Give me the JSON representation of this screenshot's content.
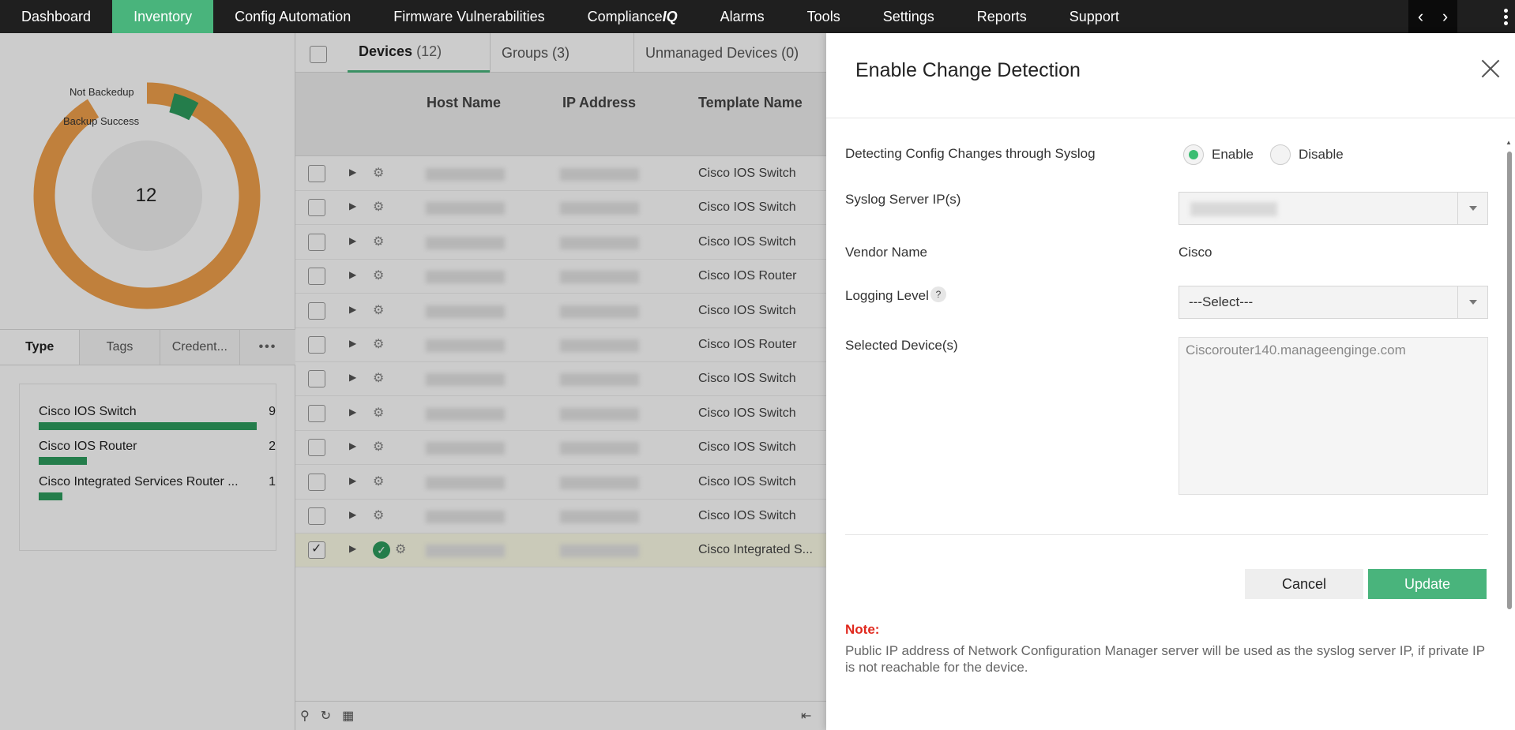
{
  "nav": {
    "items": [
      "Dashboard",
      "Inventory",
      "Config Automation",
      "Firmware Vulnerabilities",
      "Compliance",
      "Alarms",
      "Tools",
      "Settings",
      "Reports",
      "Support"
    ],
    "compliance_suffix": "IQ",
    "active": "Inventory",
    "prev_icon": "chevron-left-icon",
    "next_icon": "chevron-right-icon"
  },
  "summary": {
    "not_backedup_label": "Not Backedup",
    "backup_success_label": "Backup Success",
    "total": "12",
    "colors": {
      "not_backedup": "#f0a04b",
      "backup_success": "#2e9d5e"
    }
  },
  "left_tabs": [
    "Type",
    "Tags",
    "Credent...",
    "•••"
  ],
  "types": [
    {
      "label": "Cisco IOS Switch",
      "count": "9",
      "fraction": 1.0
    },
    {
      "label": "Cisco IOS Router",
      "count": "2",
      "fraction": 0.22
    },
    {
      "label": "Cisco Integrated Services Router ...",
      "count": "1",
      "fraction": 0.11
    }
  ],
  "device_tabs": [
    {
      "label": "Devices",
      "count": "(12)"
    },
    {
      "label": "Groups",
      "count": "(3)"
    },
    {
      "label": "Unmanaged Devices",
      "count": "(0)"
    }
  ],
  "table": {
    "headers": [
      "Host Name",
      "IP Address",
      "Template Name"
    ],
    "rows": [
      "Cisco IOS Switch",
      "Cisco IOS Switch",
      "Cisco IOS Switch",
      "Cisco IOS Router",
      "Cisco IOS Switch",
      "Cisco IOS Router",
      "Cisco IOS Switch",
      "Cisco IOS Switch",
      "Cisco IOS Switch",
      "Cisco IOS Switch",
      "Cisco IOS Switch",
      "Cisco Integrated S..."
    ]
  },
  "dialog": {
    "title": "Enable Change Detection",
    "syslog_label": "Detecting Config Changes through Syslog",
    "enable_label": "Enable",
    "disable_label": "Disable",
    "syslog_enabled": true,
    "server_label": "Syslog Server IP(s)",
    "vendor_label": "Vendor Name",
    "vendor_value": "Cisco",
    "logging_label": "Logging Level",
    "logging_help": "?",
    "logging_value": "---Select---",
    "devices_label": "Selected Device(s)",
    "devices_value": "Ciscorouter140.manageenginge.com",
    "cancel_label": "Cancel",
    "update_label": "Update",
    "note_heading": "Note:",
    "note_text": "Public IP address of Network Configuration Manager server will be used as the syslog server IP, if private IP is not reachable for the device."
  }
}
